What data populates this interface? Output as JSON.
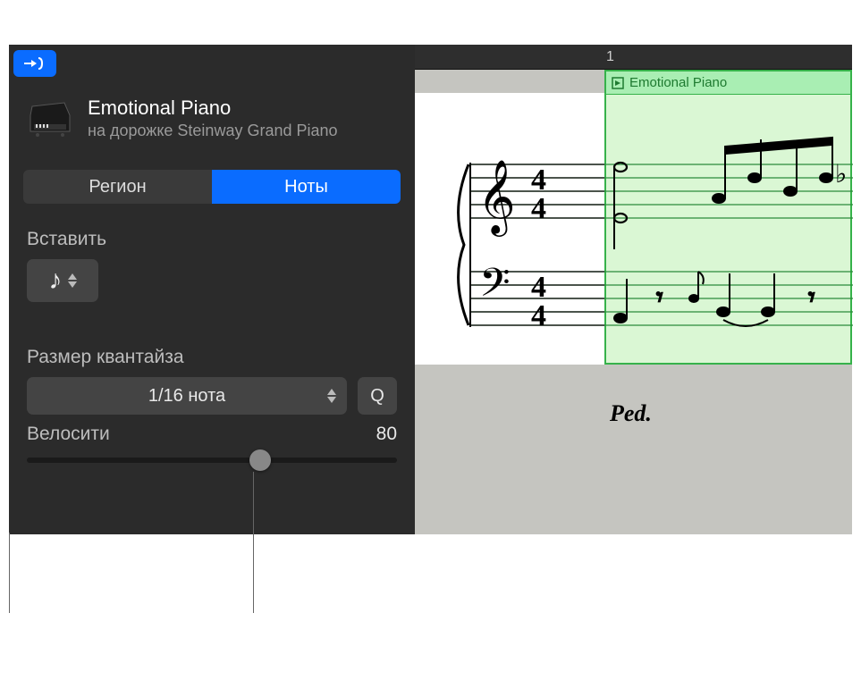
{
  "header": {
    "region_title": "Emotional Piano",
    "region_subtitle": "на дорожке Steinway Grand Piano"
  },
  "tabs": {
    "region": "Регион",
    "notes": "Ноты"
  },
  "insert": {
    "label": "Вставить",
    "note_glyph": "♪"
  },
  "quantize": {
    "label": "Размер квантайза",
    "value": "1/16 нота",
    "q_btn": "Q"
  },
  "velocity": {
    "label": "Велосити",
    "value": "80",
    "percent": 63
  },
  "ruler": {
    "bar1": "1"
  },
  "clip": {
    "title": "Emotional Piano",
    "pedal": "Ped."
  }
}
